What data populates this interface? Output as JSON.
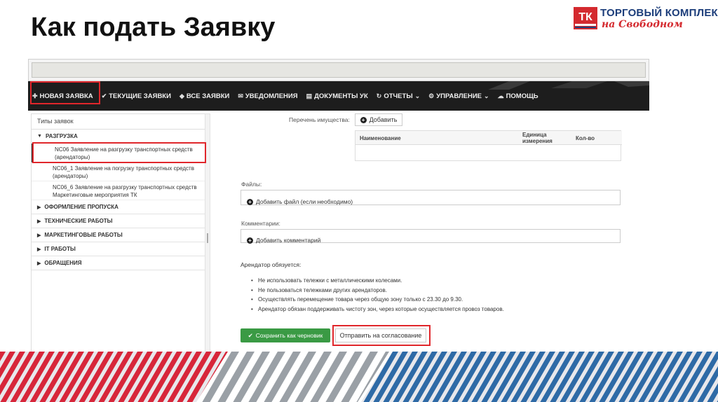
{
  "slide": {
    "title": "Как подать Заявку"
  },
  "logo": {
    "mark": "ТК",
    "line1": "ТОРГОВЫЙ КОМПЛЕКС",
    "line2": "на Свободном",
    "colors": {
      "red": "#d42a2f",
      "blue": "#1c3d7a"
    }
  },
  "navbar": {
    "items": [
      {
        "icon": "plus-icon",
        "label": "НОВАЯ ЗАЯВКА"
      },
      {
        "icon": "check-icon",
        "label": "ТЕКУЩИЕ ЗАЯВКИ"
      },
      {
        "icon": "tag-icon",
        "label": "ВСЕ ЗАЯВКИ"
      },
      {
        "icon": "envelope-icon",
        "label": "УВЕДОМЛЕНИЯ"
      },
      {
        "icon": "document-icon",
        "label": "ДОКУМЕНТЫ УК"
      },
      {
        "icon": "refresh-icon",
        "label": "ОТЧЕТЫ"
      },
      {
        "icon": "gears-icon",
        "label": "УПРАВЛЕНИЕ"
      },
      {
        "icon": "chat-icon",
        "label": "ПОМОЩЬ"
      }
    ]
  },
  "sidebar": {
    "header": "Типы заявок",
    "categories": [
      {
        "label": "РАЗГРУЗКА",
        "expanded": true
      },
      {
        "label": "ОФОРМЛЕНИЕ ПРОПУСКА",
        "expanded": false
      },
      {
        "label": "ТЕХНИЧЕСКИЕ РАБОТЫ",
        "expanded": false
      },
      {
        "label": "МАРКЕТИНГОВЫЕ РАБОТЫ",
        "expanded": false
      },
      {
        "label": "IT РАБОТЫ",
        "expanded": false
      },
      {
        "label": "ОБРАЩЕНИЯ",
        "expanded": false
      }
    ],
    "items": [
      {
        "line1": "NC06 Заявление на разгрузку транспортных средств",
        "line2": "(арендаторы)"
      },
      {
        "line1": "NC06_1 Заявление на погрузку транспортных средств",
        "line2": "(арендаторы)"
      },
      {
        "line1": "NC06_6 Заявление на разгрузку транспортных средств",
        "line2": "Маркетинговые мероприятия ТК"
      }
    ]
  },
  "form": {
    "property_list_label": "Перечень имущества:",
    "add_button": "Добавить",
    "table_headers": {
      "name": "Наименование",
      "unit_line1": "Единица",
      "unit_line2": "измерения",
      "qty": "Кол-во"
    },
    "files_label": "Файлы:",
    "add_file": "Добавить файл (если необходимо)",
    "comments_label": "Комментарии:",
    "add_comment": "Добавить комментарий",
    "obligations_title": "Арендатор обязуется:",
    "obligations": [
      "Не использовать тележки с металлическими колесами.",
      "Не пользоваться тележками других арендаторов.",
      "Осуществлять перемещение товара через общую зону только с 23.30 до 9.30.",
      "Арендатор обязан поддерживать чистоту зон, через которые осуществляется провоз товаров."
    ],
    "save_draft": "Сохранить как черновик",
    "submit": "Отправить на согласование"
  },
  "colors": {
    "highlight": "#e0262b",
    "green": "#3a9a44",
    "navbar": "#1d1d1d"
  }
}
